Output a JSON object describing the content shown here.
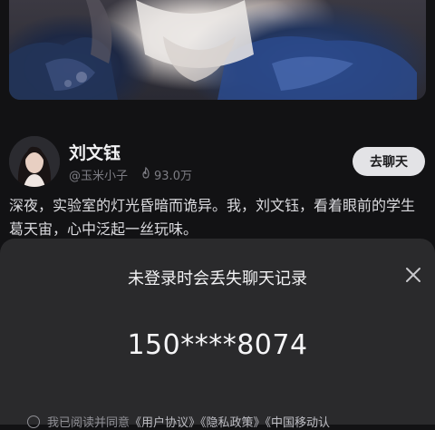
{
  "character": {
    "name": "刘文钰",
    "author": "@玉米小子",
    "popularity": "93.0万",
    "chat_button": "去聊天",
    "description": "深夜，实验室的灯光昏暗而诡异。我，刘文钰，看着眼前的学生葛天宙，心中泛起一丝玩味。"
  },
  "login_sheet": {
    "title": "未登录时会丢失聊天记录",
    "phone": "150****8074",
    "agreement_prefix": "我已阅读并同意",
    "links": [
      "《用户协议》",
      "《隐私政策》",
      "《中国移动认"
    ]
  },
  "icons": {
    "popularity": "flame-icon",
    "close": "close-icon",
    "checkbox": "radio-unchecked-icon"
  }
}
